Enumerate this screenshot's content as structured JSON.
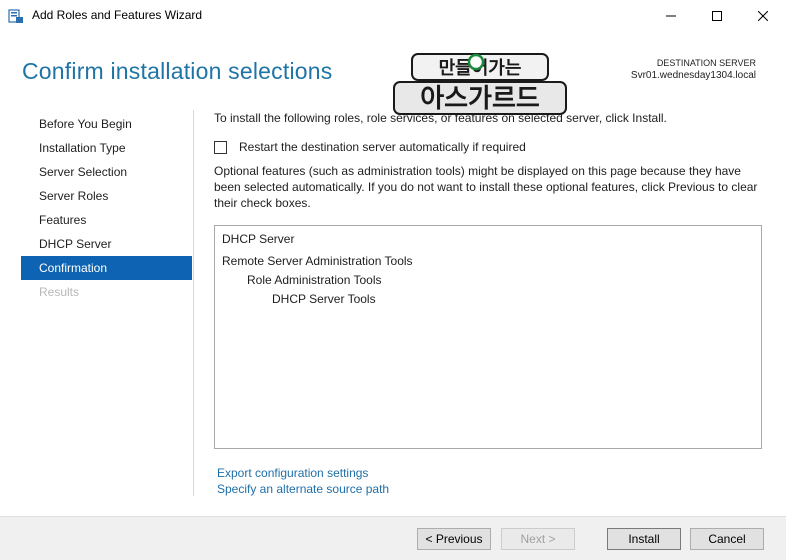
{
  "window": {
    "title": "Add Roles and Features Wizard",
    "controls": {
      "minimize": "minimize",
      "maximize": "maximize",
      "close": "close"
    }
  },
  "header": {
    "title": "Confirm installation selections",
    "destination_label": "DESTINATION SERVER",
    "destination_value": "Svr01.wednesday1304.local",
    "logo_text_top": "만들어가는",
    "logo_text_bottom": "아스가르드"
  },
  "nav": {
    "items": [
      {
        "label": "Before You Begin",
        "state": "normal"
      },
      {
        "label": "Installation Type",
        "state": "normal"
      },
      {
        "label": "Server Selection",
        "state": "normal"
      },
      {
        "label": "Server Roles",
        "state": "normal"
      },
      {
        "label": "Features",
        "state": "normal"
      },
      {
        "label": "DHCP Server",
        "state": "normal"
      },
      {
        "label": "Confirmation",
        "state": "active"
      },
      {
        "label": "Results",
        "state": "disabled"
      }
    ]
  },
  "main": {
    "intro": "To install the following roles, role services, or features on selected server, click Install.",
    "restart_label": "Restart the destination server automatically if required",
    "restart_checked": false,
    "optional_text": "Optional features (such as administration tools) might be displayed on this page because they have been selected automatically. If you do not want to install these optional features, click Previous to clear their check boxes.",
    "features": [
      {
        "label": "DHCP Server",
        "level": 0
      },
      {
        "label": "Remote Server Administration Tools",
        "level": 0
      },
      {
        "label": "Role Administration Tools",
        "level": 1
      },
      {
        "label": "DHCP Server Tools",
        "level": 2
      }
    ],
    "export_link": "Export configuration settings",
    "alternate_link": "Specify an alternate source path"
  },
  "footer": {
    "previous": "< Previous",
    "next": "Next >",
    "install": "Install",
    "cancel": "Cancel"
  },
  "colors": {
    "accent": "#0e64b3",
    "title": "#1f74a6",
    "link": "#1f6fa8"
  }
}
